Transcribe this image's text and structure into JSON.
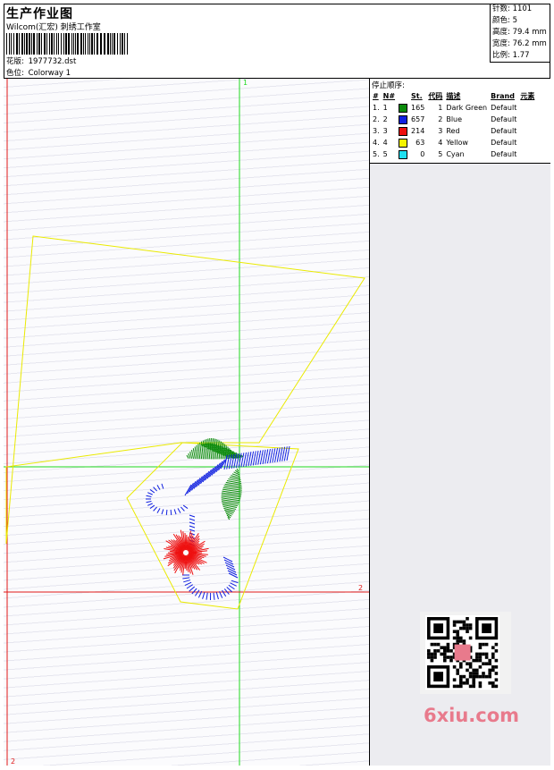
{
  "header": {
    "title": "生产作业图",
    "company": "Wilcom(汇宏) 刺绣工作室",
    "design_label": "花版:",
    "design_value": "1977732.dst",
    "colorway_label": "色位:",
    "colorway_value": "Colorway 1"
  },
  "stats": {
    "stitches_label": "针数:",
    "stitches_value": "1101",
    "colors_label": "颜色:",
    "colors_value": "5",
    "height_label": "高度:",
    "height_value": "79.4 mm",
    "width_label": "宽度:",
    "width_value": "76.2 mm",
    "scale_label": "比例:",
    "scale_value": "1.77"
  },
  "stop_sequence": {
    "title": "停止顺序:",
    "columns": [
      "#",
      "N#",
      "St.",
      "代码",
      "描述",
      "Brand",
      "元素"
    ],
    "rows": [
      {
        "idx": "1.",
        "n": "1",
        "color": "#0a8a0a",
        "st": "165",
        "code": "1",
        "desc": "Dark Green",
        "brand": "Default"
      },
      {
        "idx": "2.",
        "n": "2",
        "color": "#1020e0",
        "st": "657",
        "code": "2",
        "desc": "Blue",
        "brand": "Default"
      },
      {
        "idx": "3.",
        "n": "3",
        "color": "#ee1010",
        "st": "214",
        "code": "3",
        "desc": "Red",
        "brand": "Default"
      },
      {
        "idx": "4.",
        "n": "4",
        "color": "#f4f400",
        "st": "63",
        "code": "4",
        "desc": "Yellow",
        "brand": "Default"
      },
      {
        "idx": "5.",
        "n": "5",
        "color": "#20e0f0",
        "st": "0",
        "code": "5",
        "desc": "Cyan",
        "brand": "Default"
      }
    ]
  },
  "axes": {
    "top_label": "1",
    "right_label": "2",
    "bottom_label": "2",
    "green_color": "#20d820",
    "red_color": "#e01818"
  },
  "watermark": "6xiu.com"
}
